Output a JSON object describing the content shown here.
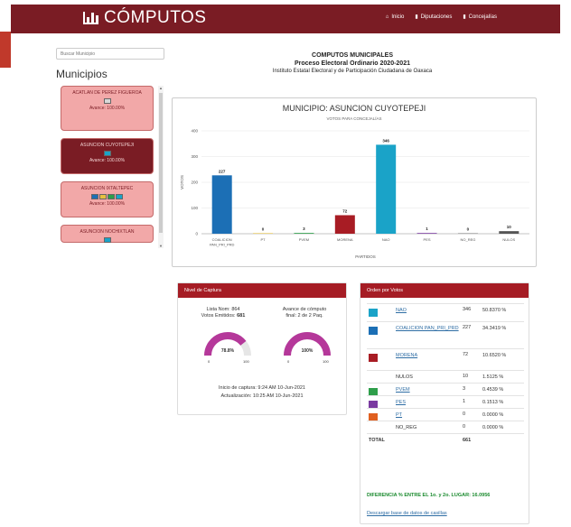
{
  "nav": {
    "brand": "CÓMPUTOS",
    "links": [
      {
        "icon": "home-icon",
        "label": "Inicio"
      },
      {
        "icon": "chart-icon",
        "label": "Diputaciones"
      },
      {
        "icon": "chart-icon",
        "label": "Concejalías"
      }
    ]
  },
  "sidebar": {
    "search_placeholder": "Buscar Municipio",
    "title": "Municipios",
    "items": [
      {
        "name": "ACATLAN DE PEREZ FIGUEROA",
        "avance": "Avance: 100.00%",
        "active": false
      },
      {
        "name": "ASUNCION CUYOTEPEJI",
        "avance": "Avance: 100.00%",
        "active": true
      },
      {
        "name": "ASUNCION IXTALTEPEC",
        "avance": "Avance: 100.00%",
        "active": false
      },
      {
        "name": "ASUNCION NOCHIXTLAN",
        "avance": "",
        "active": false
      }
    ]
  },
  "header": {
    "line1": "COMPUTOS MUNICIPALES",
    "line2": "Proceso Electoral Ordinario 2020-2021",
    "line3": "Instituto Estatal Electoral y de Participación Ciudadana de Oaxaca"
  },
  "chart_title": "MUNICIPIO: ASUNCION CUYOTEPEJI",
  "chart_data": {
    "type": "bar",
    "title": "VOTOS PARA CONCEJALÍAS",
    "xlabel": "PARTIDOS",
    "ylabel": "VOTOS",
    "ylim": [
      0,
      400
    ],
    "yticks": [
      0,
      100,
      200,
      300,
      400
    ],
    "categories": [
      "COALICION PAN_PRI_PRD",
      "PT",
      "PVEM",
      "MORENA",
      "NAO",
      "PES",
      "NO_REG",
      "NULOS"
    ],
    "value_labels": [
      "227",
      "0",
      "3",
      "72",
      "346",
      "1",
      "0",
      "10"
    ],
    "values": [
      227,
      0,
      3,
      72,
      346,
      1,
      0,
      10
    ],
    "colors": [
      "#1c6fb5",
      "#e6c040",
      "#2e9e4a",
      "#a81c24",
      "#1aa3c8",
      "#7a3aa0",
      "#888888",
      "#555555"
    ]
  },
  "captura": {
    "head": "Nivel de Captura",
    "lista_nom": "Lista Nom: 864",
    "votos_emitidos_label": "Votos Emitidos:",
    "votos_emitidos": "681",
    "avance_line1": "Avance de cómputo",
    "avance_line2": "final: 2 de 2 Paq.",
    "gauge1_value": "78.8%",
    "gauge1_fraction": 0.788,
    "gauge2_value": "100%",
    "gauge2_fraction": 1.0,
    "gauge_min": "0",
    "gauge_max": "100",
    "inicio": "Inicio de captura: 9:24 AM 10-Jun-2021",
    "actualizacion": "Actualización: 10:25 AM 10-Jun-2021"
  },
  "orden": {
    "head": "Orden por Votos",
    "rows": [
      {
        "name": "NAO",
        "votes": "346",
        "pct": "50.8370 %",
        "link": true,
        "color": "#1aa3c8"
      },
      {
        "name": "COALICION PAN_PRI_PRD",
        "votes": "227",
        "pct": "34.3419 %",
        "link": true,
        "color": "#1c6fb5"
      },
      {
        "name": "MORENA",
        "votes": "72",
        "pct": "10.6520 %",
        "link": true,
        "color": "#a81c24"
      },
      {
        "name": "NULOS",
        "votes": "10",
        "pct": "1.5125 %",
        "link": false,
        "color": ""
      },
      {
        "name": "PVEM",
        "votes": "3",
        "pct": "0.4539 %",
        "link": true,
        "color": "#2e9e4a"
      },
      {
        "name": "PES",
        "votes": "1",
        "pct": "0.1513 %",
        "link": true,
        "color": "#7a3aa0"
      },
      {
        "name": "PT",
        "votes": "0",
        "pct": "0.0000 %",
        "link": true,
        "color": "#e06020"
      },
      {
        "name": "NO_REG",
        "votes": "0",
        "pct": "0.0000 %",
        "link": false,
        "color": ""
      }
    ],
    "total_label": "TOTAL",
    "total": "661",
    "diferencia": "DIFERENCIA % ENTRE EL 1o. y 2o. LUGAR: 16.0956",
    "download": "Descargar base de datos de casillas"
  }
}
